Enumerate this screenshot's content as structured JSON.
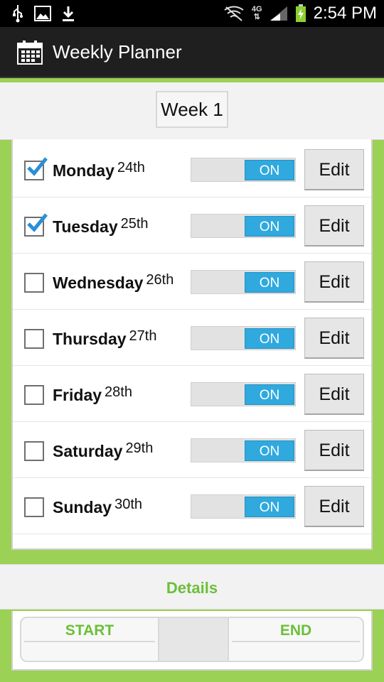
{
  "status_bar": {
    "time": "2:54 PM",
    "network": "4G",
    "icons": [
      "usb-icon",
      "image-icon",
      "download-icon",
      "wifi-off-icon",
      "signal-icon",
      "battery-charging-icon"
    ]
  },
  "action_bar": {
    "title": "Weekly Planner",
    "icon": "calendar-icon"
  },
  "week": {
    "label": "Week 1"
  },
  "days": [
    {
      "name": "Monday",
      "date": "24th",
      "checked": true,
      "toggle": "ON",
      "edit": "Edit"
    },
    {
      "name": "Tuesday",
      "date": "25th",
      "checked": true,
      "toggle": "ON",
      "edit": "Edit"
    },
    {
      "name": "Wednesday",
      "date": "26th",
      "checked": false,
      "toggle": "ON",
      "edit": "Edit"
    },
    {
      "name": "Thursday",
      "date": "27th",
      "checked": false,
      "toggle": "ON",
      "edit": "Edit"
    },
    {
      "name": "Friday",
      "date": "28th",
      "checked": false,
      "toggle": "ON",
      "edit": "Edit"
    },
    {
      "name": "Saturday",
      "date": "29th",
      "checked": false,
      "toggle": "ON",
      "edit": "Edit"
    },
    {
      "name": "Sunday",
      "date": "30th",
      "checked": false,
      "toggle": "ON",
      "edit": "Edit"
    }
  ],
  "details": {
    "label": "Details"
  },
  "pickers": {
    "start": "START",
    "end": "END"
  },
  "colors": {
    "accent_green": "#9bd154",
    "toggle_blue": "#2fa9de",
    "label_green": "#6cbf3a",
    "check_blue": "#2a8fd6"
  }
}
